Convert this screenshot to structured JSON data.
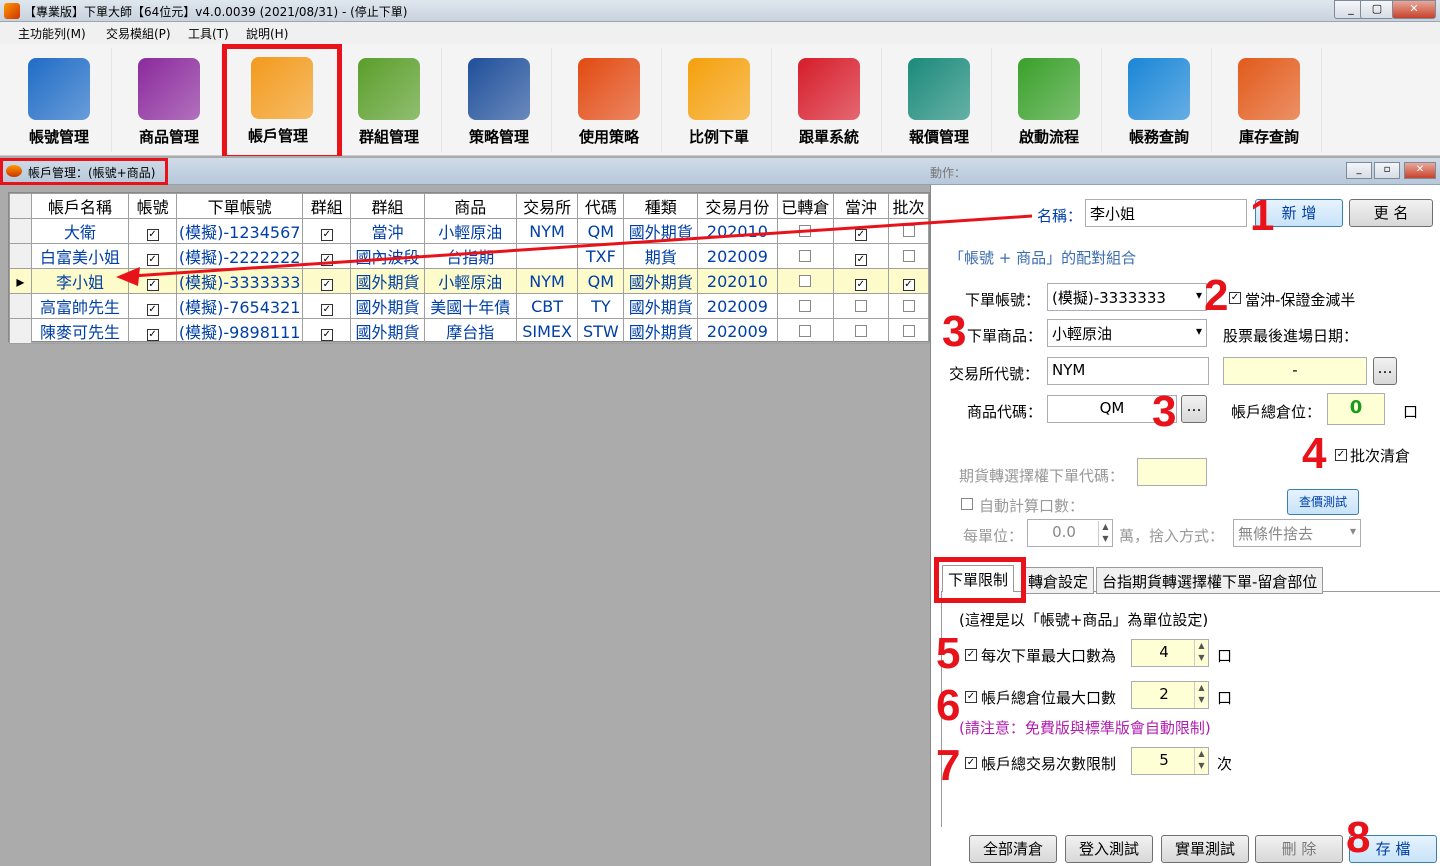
{
  "window": {
    "title": "【專業版】下單大師【64位元】v4.0.0039 (2021/08/31) - (停止下單)"
  },
  "menu": [
    "主功能列(M)",
    "交易模組(P)",
    "工具(T)",
    "說明(H)"
  ],
  "toolbar": [
    {
      "label": "帳號管理",
      "icon": "users-icon",
      "color": "#1f6cc6"
    },
    {
      "label": "商品管理",
      "icon": "wallet-icon",
      "color": "#8b2a9c"
    },
    {
      "label": "帳戶管理",
      "icon": "folder-users-icon",
      "color": "#f29a1c"
    },
    {
      "label": "群組管理",
      "icon": "share-icon",
      "color": "#5a9e2a"
    },
    {
      "label": "策略管理",
      "icon": "checklist-icon",
      "color": "#1f4f9a"
    },
    {
      "label": "使用策略",
      "icon": "hand-chart-icon",
      "color": "#e24a12"
    },
    {
      "label": "比例下單",
      "icon": "pie-chart-icon",
      "color": "#f5a00c"
    },
    {
      "label": "跟單系統",
      "icon": "bar-people-icon",
      "color": "#d61c2a"
    },
    {
      "label": "報價管理",
      "icon": "globe-icon",
      "color": "#1a8a7a"
    },
    {
      "label": "啟動流程",
      "icon": "flowchart-icon",
      "color": "#3aa02a"
    },
    {
      "label": "帳務查詢",
      "icon": "piggy-bank-icon",
      "color": "#1a86d6"
    },
    {
      "label": "庫存查詢",
      "icon": "report-icon",
      "color": "#e25a1a"
    }
  ],
  "subwindow": {
    "title": "帳戶管理：(帳號+商品)",
    "faded_label": "動作："
  },
  "grid": {
    "headers": [
      "帳戶名稱",
      "帳號",
      "下單帳號",
      "群組",
      "群組",
      "商品",
      "交易所",
      "代碼",
      "種類",
      "交易月份",
      "已轉倉",
      "當沖",
      "批次"
    ],
    "rows": [
      {
        "name": "大衛",
        "account": "(模擬)-1234567",
        "group": "當沖",
        "product": "小輕原油",
        "exchange": "NYM",
        "code": "QM",
        "kind": "國外期貨",
        "month": "202010",
        "c": [
          true,
          true,
          false,
          true,
          false
        ]
      },
      {
        "name": "白富美小姐",
        "account": "(模擬)-2222222",
        "group": "國內波段",
        "product": "台指期",
        "exchange": "",
        "code": "TXF",
        "kind": "期貨",
        "month": "202009",
        "c": [
          true,
          true,
          false,
          true,
          false
        ]
      },
      {
        "name": "李小姐",
        "account": "(模擬)-3333333",
        "group": "國外期貨",
        "product": "小輕原油",
        "exchange": "NYM",
        "code": "QM",
        "kind": "國外期貨",
        "month": "202010",
        "c": [
          true,
          true,
          false,
          true,
          true
        ]
      },
      {
        "name": "高富帥先生",
        "account": "(模擬)-7654321",
        "group": "國外期貨",
        "product": "美國十年債",
        "exchange": "CBT",
        "code": "TY",
        "kind": "國外期貨",
        "month": "202009",
        "c": [
          true,
          true,
          false,
          false,
          false
        ]
      },
      {
        "name": "陳麥可先生",
        "account": "(模擬)-9898111",
        "group": "國外期貨",
        "product": "摩台指",
        "exchange": "SIMEX",
        "code": "STW",
        "kind": "國外期貨",
        "month": "202009",
        "c": [
          true,
          true,
          false,
          false,
          false
        ]
      }
    ]
  },
  "form": {
    "name_label": "名稱：",
    "name_value": "李小姐",
    "new_btn": "新 增",
    "rename_btn": "更 名",
    "section": "「帳號 + 商品」的配對組合",
    "account_label": "下單帳號：",
    "account_value": "(模擬)-3333333",
    "daytrade_label": "當沖-保證金減半",
    "product_label": "下單商品：",
    "product_value": "小輕原油",
    "stock_date_label": "股票最後進場日期：",
    "stock_date_value": "-",
    "exchange_label": "交易所代號：",
    "exchange_value": "NYM",
    "code_label": "商品代碼：",
    "code_value": "QM",
    "position_label": "帳戶總倉位：",
    "position_value": "0",
    "position_unit": "口",
    "batch_label": "批次清倉",
    "opt_label": "期貨轉選擇權下單代碼：",
    "auto_label": "自動計算口數：",
    "quote_btn": "查價測試",
    "unit_label": "每單位：",
    "unit_value": "0.0",
    "unit_suffix": "萬，捨入方式：",
    "round_value": "無條件捨去"
  },
  "tabs": [
    "下單限制",
    "轉倉設定",
    "台指期貨轉選擇權下單-留倉部位"
  ],
  "limits": {
    "note": "(這裡是以「帳號+商品」為單位設定)",
    "max_order_label": "每次下單最大口數為",
    "max_order_value": "4",
    "unit1": "口",
    "max_pos_label": "帳戶總倉位最大口數",
    "max_pos_value": "2",
    "unit2": "口",
    "warning": "(請注意：免費版與標準版會自動限制)",
    "trade_count_label": "帳戶總交易次數限制",
    "trade_count_value": "5",
    "unit3": "次"
  },
  "bottom_buttons": [
    "全部清倉",
    "登入測試",
    "實單測試",
    "刪 除",
    "存 檔"
  ],
  "annotations": [
    "1",
    "2",
    "3",
    "3",
    "4",
    "5",
    "6",
    "7",
    "8"
  ]
}
